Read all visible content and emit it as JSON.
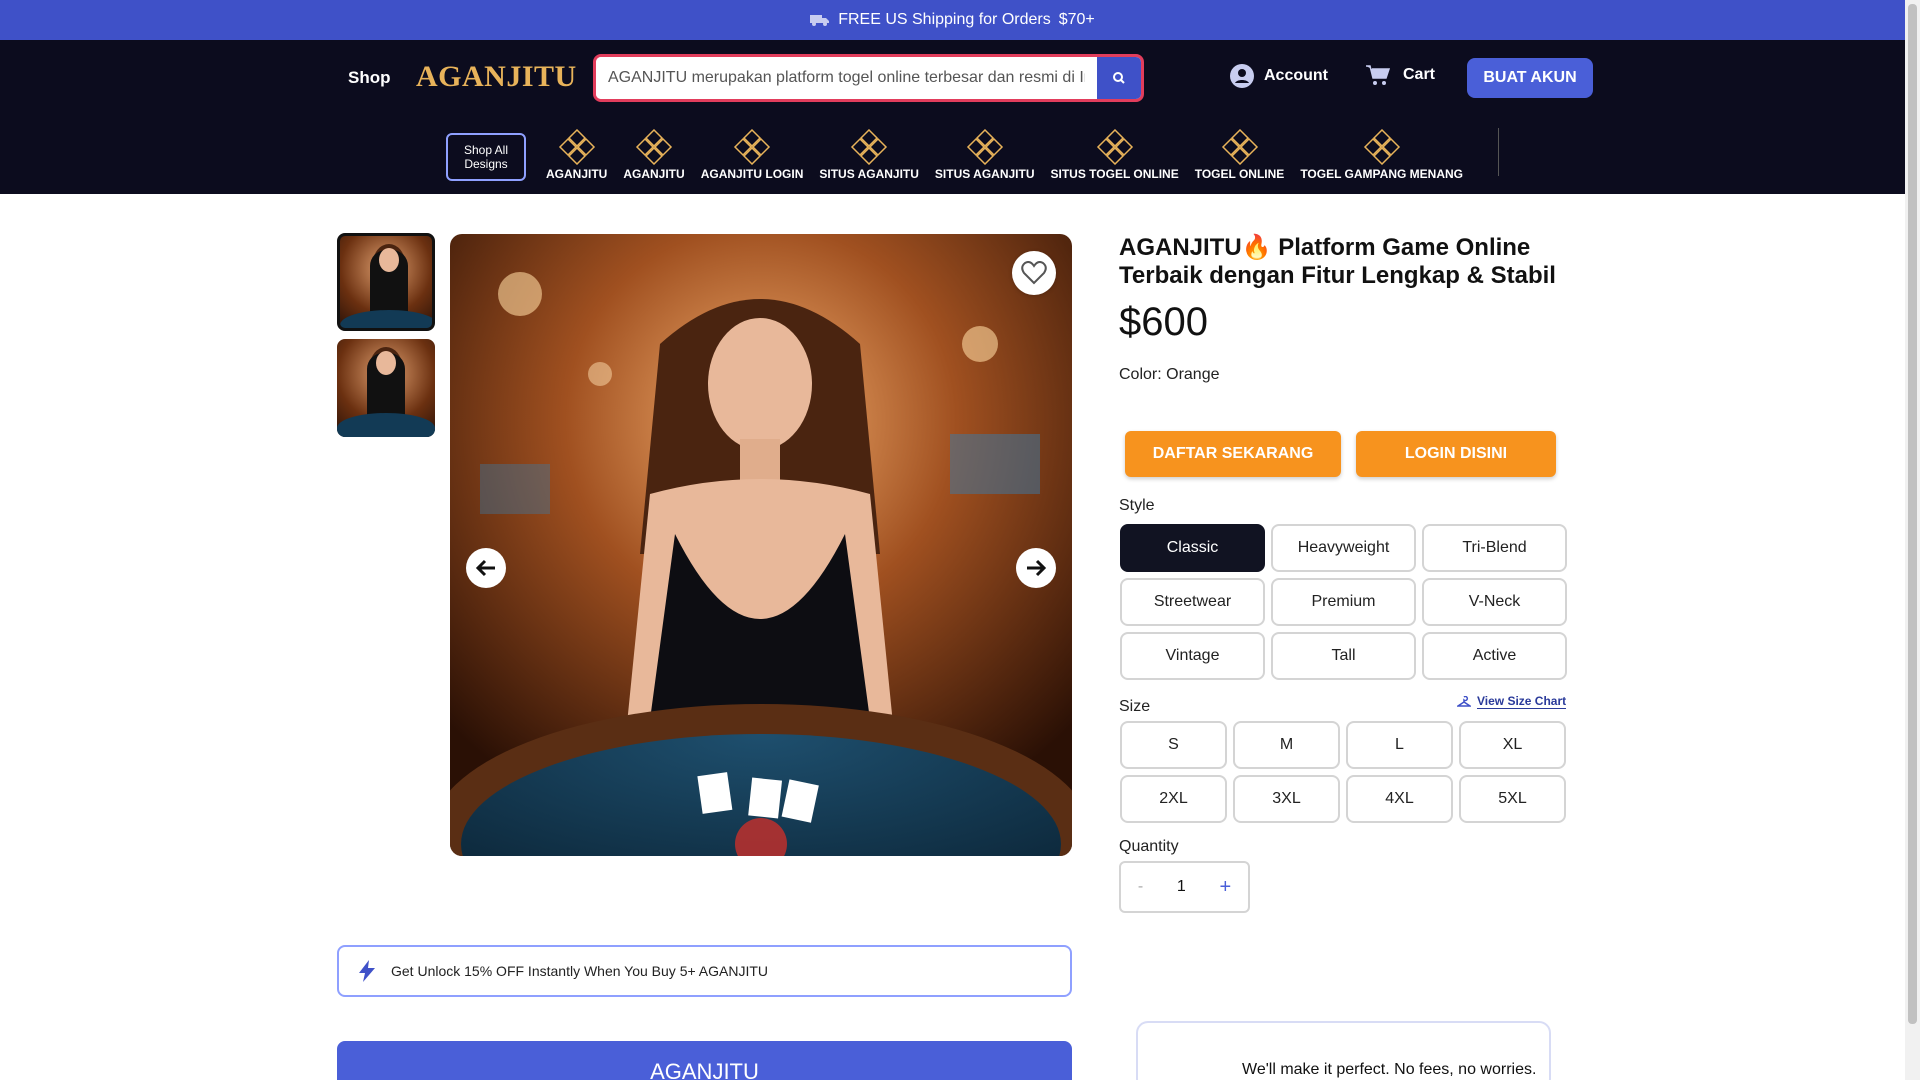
{
  "topbar": {
    "shipping_text": "FREE US Shipping for Orders",
    "shipping_amount": "$70+"
  },
  "header": {
    "shop_label": "Shop",
    "logo_text": "AGANJITU",
    "search_value": "AGANJITU merupakan platform togel online terbesar dan resmi di Indonesia.",
    "account_label": "Account",
    "cart_label": "Cart",
    "cta_label": "BUAT AKUN"
  },
  "categories": {
    "shop_all_line1": "Shop All",
    "shop_all_line2": "Designs",
    "items": [
      {
        "label": "AGANJITU"
      },
      {
        "label": "AGANJITU"
      },
      {
        "label": "AGANJITU LOGIN"
      },
      {
        "label": "SITUS AGANJITU"
      },
      {
        "label": "SITUS AGANJITU"
      },
      {
        "label": "SITUS TOGEL ONLINE"
      },
      {
        "label": "TOGEL ONLINE"
      },
      {
        "label": "TOGEL GAMPANG MENANG"
      }
    ]
  },
  "product": {
    "title": "AGANJITU🔥 Platform Game Online Terbaik dengan Fitur Lengkap & Stabil",
    "price": "$600",
    "color_label": "Color: Orange",
    "daftar_label": "DAFTAR SEKARANG",
    "login_label": "LOGIN DISINI",
    "style_label": "Style",
    "styles": [
      "Classic",
      "Heavyweight",
      "Tri-Blend",
      "Streetwear",
      "Premium",
      "V-Neck",
      "Vintage",
      "Tall",
      "Active"
    ],
    "selected_style": "Classic",
    "size_label": "Size",
    "size_chart_label": "View Size Chart",
    "sizes": [
      "S",
      "M",
      "L",
      "XL",
      "2XL",
      "3XL",
      "4XL",
      "5XL"
    ],
    "quantity_label": "Quantity",
    "quantity_minus": "-",
    "quantity_value": "1",
    "quantity_plus": "+"
  },
  "promo": {
    "text": "Get Unlock 15% OFF Instantly When You Buy 5+ AGANJITU"
  },
  "bottom_button": {
    "label": "AGANJITU"
  },
  "guarantee": {
    "text": "We'll make it perfect. No fees, no worries."
  },
  "colors": {
    "accent": "#3f51c8",
    "header_bg": "#0c0c1e",
    "cta_orange": "#f7931e",
    "logo_gold": "#e8b35a"
  }
}
